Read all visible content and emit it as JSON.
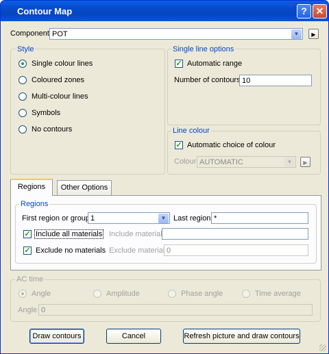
{
  "window": {
    "title": "Contour Map",
    "help_label": "?",
    "close_label": "✕"
  },
  "component": {
    "label": "Component",
    "value": "POT",
    "dropdown_icon": "chevron-down-icon",
    "next_icon": "triangle-right-icon"
  },
  "style": {
    "title": "Style",
    "options": [
      "Single colour lines",
      "Coloured zones",
      "Multi-colour lines",
      "Symbols",
      "No contours"
    ],
    "selected": "Single colour lines"
  },
  "single_line": {
    "title": "Single line options",
    "automatic_range_label": "Automatic range",
    "automatic_range_checked": true,
    "num_contours_label": "Number of contours",
    "num_contours_value": "10"
  },
  "line_colour": {
    "title": "Line colour",
    "auto_label": "Automatic choice of colour",
    "auto_checked": true,
    "colour_label": "Colour",
    "colour_value": "AUTOMATIC"
  },
  "tabs": {
    "items": [
      "Regions",
      "Other Options"
    ],
    "active": "Regions"
  },
  "regions": {
    "title": "Regions",
    "first_label": "First region or group",
    "first_value": "1",
    "last_label": "Last region",
    "last_value": "*",
    "include_all_label": "Include all materials",
    "include_all_checked": true,
    "include_material_label": "Include material",
    "include_material_value": "",
    "exclude_no_label": "Exclude no materials",
    "exclude_no_checked": true,
    "exclude_material_label": "Exclude material",
    "exclude_material_value": "0"
  },
  "ac_time": {
    "title": "AC time",
    "options": [
      "Angle",
      "Amplitude",
      "Phase angle",
      "Time average"
    ],
    "selected": "Angle",
    "angle_label": "Angle",
    "angle_value": "0"
  },
  "buttons": {
    "draw": "Draw contours",
    "cancel": "Cancel",
    "refresh": "Refresh picture and draw contours"
  },
  "colors": {
    "title_bar": "#0749c9",
    "accent": "#0046d5",
    "check": "#21a121"
  }
}
